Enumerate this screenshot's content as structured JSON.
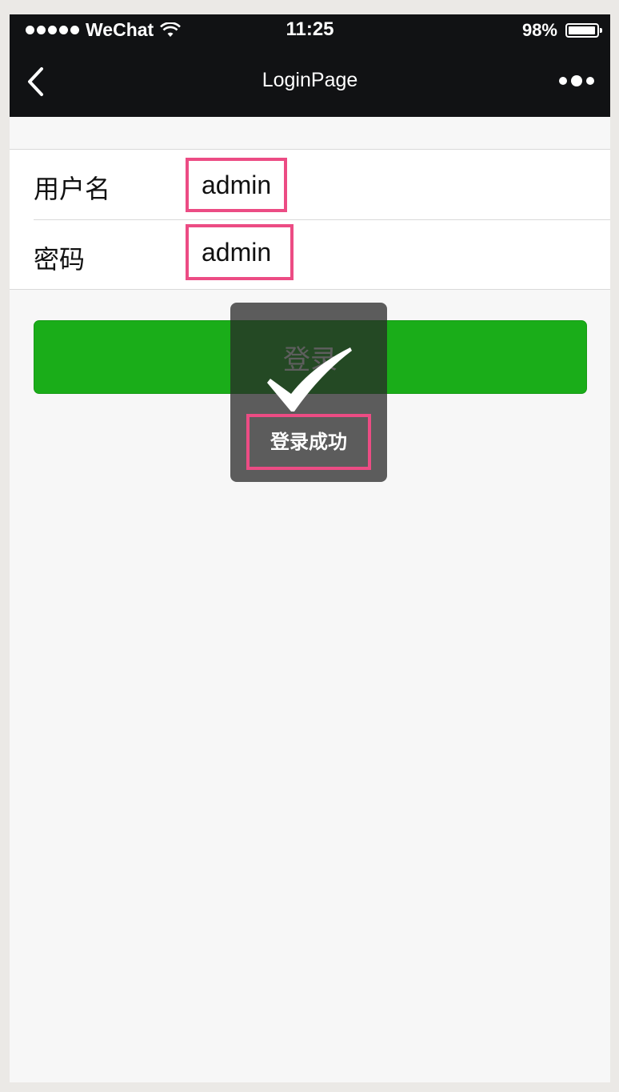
{
  "statusbar": {
    "carrier": "WeChat",
    "time": "11:25",
    "battery": "98%"
  },
  "navbar": {
    "title": "LoginPage"
  },
  "form": {
    "username_label": "用户名",
    "username_value": "admin",
    "password_label": "密码",
    "password_value": "admin"
  },
  "login_button": {
    "label": "登录",
    "color": "#1aad19"
  },
  "toast": {
    "icon": "checkmark-icon",
    "message": "登录成功"
  },
  "colors": {
    "bar_bg": "#111214",
    "highlight": "#ec4c84",
    "page_bg": "#f7f7f7"
  }
}
